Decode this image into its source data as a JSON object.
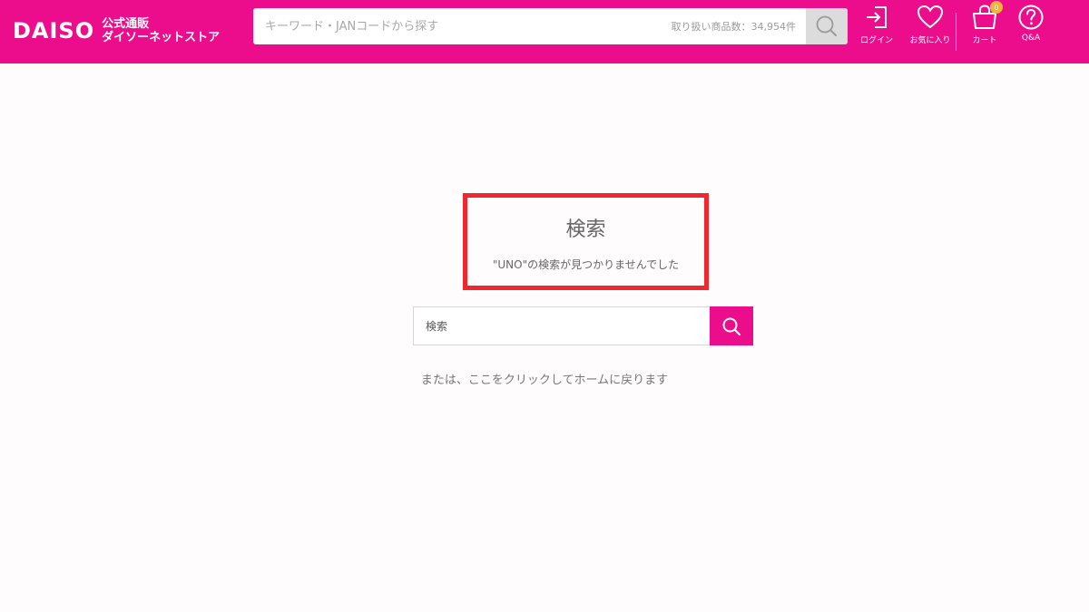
{
  "header": {
    "logo_mark": "DAISO",
    "logo_line1": "公式通販",
    "logo_line2": "ダイソーネットストア",
    "search_placeholder": "キーワード・JANコードから探す",
    "item_count": "取り扱い商品数：34,954件",
    "icons": {
      "login": {
        "label": "ログイン",
        "icon": "login-icon"
      },
      "favorites": {
        "label": "お気に入り",
        "icon": "heart-icon"
      },
      "cart": {
        "label": "カート",
        "icon": "cart-icon",
        "badge": "0"
      },
      "qa": {
        "label": "Q&A",
        "icon": "question-icon"
      }
    }
  },
  "result": {
    "title": "検索",
    "message": "\"UNO\"の検索が見つかりませんでした"
  },
  "search": {
    "placeholder": "検索"
  },
  "back_link": "または、ここをクリックしてホームに戻ります",
  "colors": {
    "brand": "#ec0d8c",
    "highlight_border": "#f0272f"
  }
}
